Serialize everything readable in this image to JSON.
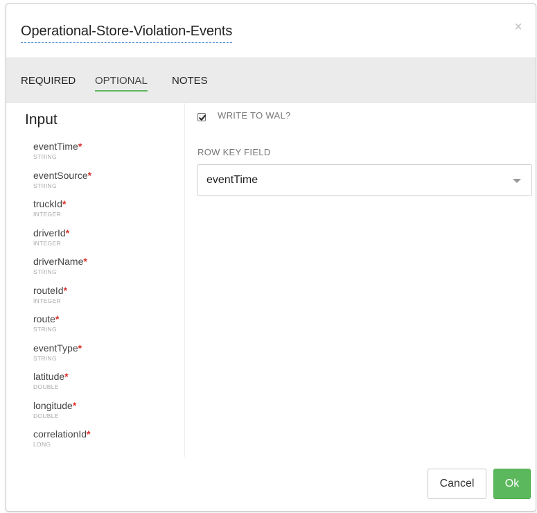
{
  "dialog": {
    "title": "Operational-Store-Violation-Events",
    "close_symbol": "×"
  },
  "tabs": [
    {
      "label": "REQUIRED",
      "active": false
    },
    {
      "label": "OPTIONAL",
      "active": true
    },
    {
      "label": "NOTES",
      "active": false
    }
  ],
  "input_panel": {
    "title": "Input",
    "required_marker": "*",
    "fields": [
      {
        "name": "eventTime",
        "type": "STRING"
      },
      {
        "name": "eventSource",
        "type": "STRING"
      },
      {
        "name": "truckId",
        "type": "INTEGER"
      },
      {
        "name": "driverId",
        "type": "INTEGER"
      },
      {
        "name": "driverName",
        "type": "STRING"
      },
      {
        "name": "routeId",
        "type": "INTEGER"
      },
      {
        "name": "route",
        "type": "STRING"
      },
      {
        "name": "eventType",
        "type": "STRING"
      },
      {
        "name": "latitude",
        "type": "DOUBLE"
      },
      {
        "name": "longitude",
        "type": "DOUBLE"
      },
      {
        "name": "correlationId",
        "type": "LONG"
      }
    ]
  },
  "options": {
    "write_to_wal": {
      "label": "WRITE TO WAL?",
      "checked": true
    },
    "row_key_field": {
      "label": "ROW KEY FIELD",
      "value": "eventTime"
    }
  },
  "footer": {
    "cancel_label": "Cancel",
    "ok_label": "Ok"
  },
  "colors": {
    "accent_green": "#5cb85c",
    "required_red": "#d9312b",
    "title_underline_blue": "#4a8ad4"
  }
}
